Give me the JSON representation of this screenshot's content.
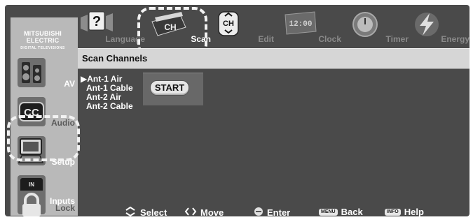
{
  "brand": {
    "name_line1": "MITSUBISHI",
    "name_line2": "ELECTRIC",
    "tagline": "DIGITAL TELEVISIONS"
  },
  "sidebar": {
    "items": [
      {
        "label": "AV",
        "icon": "speakers-icon"
      },
      {
        "label": "Audio",
        "icon": "closed-caption-icon"
      },
      {
        "label": "Setup",
        "icon": "tv-setup-icon"
      },
      {
        "label": "Inputs",
        "icon": "input-jacks-icon"
      },
      {
        "label": "Lock",
        "icon": "padlock-icon"
      }
    ]
  },
  "topmenu": {
    "items": [
      {
        "label": "Language",
        "icon": "help-question-icon"
      },
      {
        "label": "Scan",
        "icon": "channel-scan-icon",
        "active": true
      },
      {
        "label": "Edit",
        "icon": "channel-edit-icon"
      },
      {
        "label": "Clock",
        "icon": "digital-clock-icon",
        "clock_text": "12:00"
      },
      {
        "label": "Timer",
        "icon": "timer-dial-icon"
      },
      {
        "label": "Energy",
        "icon": "energy-bolt-icon"
      }
    ],
    "scan_icon_text": "CH"
  },
  "page": {
    "title": "Scan Channels"
  },
  "channels": {
    "selected_marker": "▶",
    "items": [
      "Ant-1 Air",
      "Ant-1 Cable",
      "Ant-2 Air",
      "Ant-2 Cable"
    ]
  },
  "start_button": {
    "label": "START"
  },
  "legend": {
    "select": "Select",
    "move": "Move",
    "enter": "Enter",
    "back_key": "MENU",
    "back": "Back",
    "help_key": "INFO",
    "help": "Help"
  },
  "colors": {
    "background": "#4a4a4a",
    "sidebar": "#b9b9b9",
    "header_bar": "#d6d6d6",
    "highlight_ring": "#f2f2f2"
  }
}
